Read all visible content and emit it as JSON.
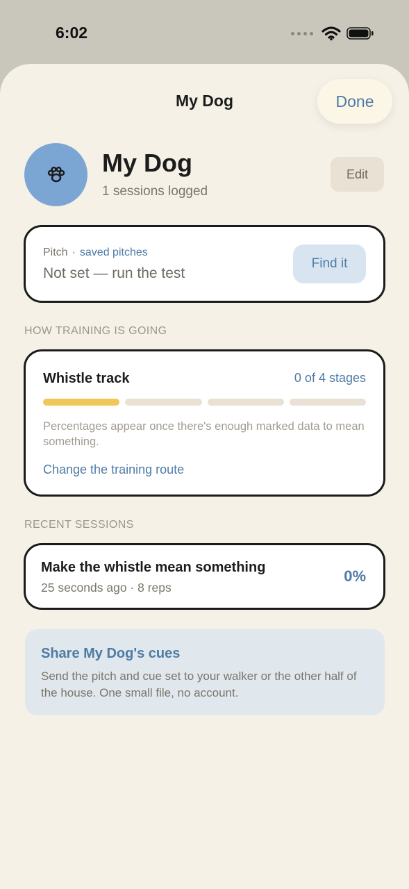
{
  "status": {
    "time": "6:02"
  },
  "nav": {
    "title": "My Dog",
    "done_label": "Done"
  },
  "profile": {
    "name": "My Dog",
    "sessions_logged": "1 sessions logged",
    "edit_label": "Edit",
    "avatar_icon": "paw-icon",
    "avatar_color": "#7ba6d4"
  },
  "pitch": {
    "label": "Pitch",
    "separator": "·",
    "saved_link": "saved pitches",
    "value": "Not set — run the test",
    "find_label": "Find it"
  },
  "training": {
    "section_header": "HOW TRAINING IS GOING",
    "track_title": "Whistle track",
    "stages": "0 of 4 stages",
    "progress_segments": 4,
    "progress_filled": 1,
    "note": "Percentages appear once there's enough marked data to mean something.",
    "route_link": "Change the training route"
  },
  "recent": {
    "section_header": "RECENT SESSIONS",
    "sessions": [
      {
        "title": "Make the whistle mean something",
        "meta": "25 seconds ago · 8 reps",
        "percent": "0%"
      }
    ]
  },
  "share": {
    "title": "Share My Dog's cues",
    "description": "Send the pitch and cue set to your walker or the other half of the house. One small file, no account."
  },
  "colors": {
    "accent": "#4e7ba6",
    "progress_fill": "#f0c75a",
    "sheet_bg": "#f5f1e6"
  }
}
